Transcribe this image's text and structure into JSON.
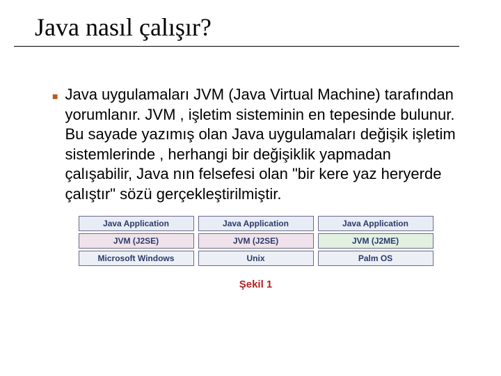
{
  "title": "Java nasıl çalışır?",
  "bullet_text": "Java uygulamaları JVM (Java Virtual Machine) tarafından yorumlanır. JVM , işletim sisteminin en tepesinde bulunur. Bu sayade yazımış olan Java uygulamaları değişik işletim sistemlerinde , herhangi bir değişiklik yapmadan çalışabilir, Java nın felsefesi olan \"bir kere yaz heryerde çalıştır\" sözü gerçekleştirilmiştir.",
  "diagram": {
    "stacks": [
      {
        "app": "Java Application",
        "jvm": "JVM (J2SE)",
        "jvm_kind": "se",
        "os": "Microsoft Windows"
      },
      {
        "app": "Java Application",
        "jvm": "JVM (J2SE)",
        "jvm_kind": "se",
        "os": "Unix"
      },
      {
        "app": "Java Application",
        "jvm": "JVM (J2ME)",
        "jvm_kind": "me",
        "os": "Palm OS"
      }
    ]
  },
  "figure_caption": "Şekil 1"
}
